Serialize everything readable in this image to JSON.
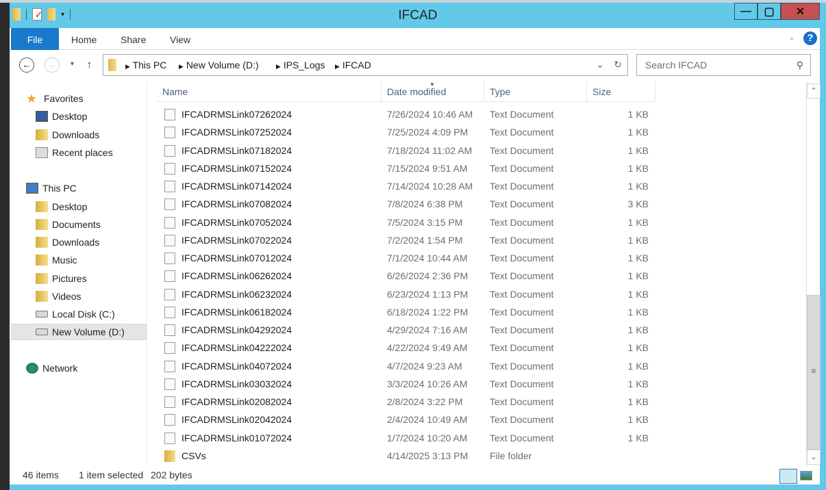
{
  "window": {
    "title": "IFCAD",
    "minimize": "—",
    "maximize": "▢",
    "close": "✕"
  },
  "ribbon": {
    "tabs": [
      "File",
      "Home",
      "Share",
      "View"
    ],
    "help": "?"
  },
  "address": {
    "crumbs": [
      "This PC",
      "New Volume (D:)",
      "IPS_Logs",
      "IFCAD"
    ]
  },
  "search": {
    "placeholder": "Search IFCAD"
  },
  "nav": {
    "favorites": "Favorites",
    "fav_items": [
      "Desktop",
      "Downloads",
      "Recent places"
    ],
    "this_pc": "This PC",
    "pc_items": [
      "Desktop",
      "Documents",
      "Downloads",
      "Music",
      "Pictures",
      "Videos",
      "Local Disk (C:)",
      "New Volume (D:)"
    ],
    "network": "Network",
    "selected": "New Volume (D:)"
  },
  "columns": {
    "name": "Name",
    "date": "Date modified",
    "type": "Type",
    "size": "Size"
  },
  "files": [
    {
      "name": "IFCADRMSLink07262024",
      "date": "7/26/2024 10:46 AM",
      "type": "Text Document",
      "size": "1 KB"
    },
    {
      "name": "IFCADRMSLink07252024",
      "date": "7/25/2024 4:09 PM",
      "type": "Text Document",
      "size": "1 KB"
    },
    {
      "name": "IFCADRMSLink07182024",
      "date": "7/18/2024 11:02 AM",
      "type": "Text Document",
      "size": "1 KB"
    },
    {
      "name": "IFCADRMSLink07152024",
      "date": "7/15/2024 9:51 AM",
      "type": "Text Document",
      "size": "1 KB"
    },
    {
      "name": "IFCADRMSLink07142024",
      "date": "7/14/2024 10:28 AM",
      "type": "Text Document",
      "size": "1 KB"
    },
    {
      "name": "IFCADRMSLink07082024",
      "date": "7/8/2024 6:38 PM",
      "type": "Text Document",
      "size": "3 KB"
    },
    {
      "name": "IFCADRMSLink07052024",
      "date": "7/5/2024 3:15 PM",
      "type": "Text Document",
      "size": "1 KB"
    },
    {
      "name": "IFCADRMSLink07022024",
      "date": "7/2/2024 1:54 PM",
      "type": "Text Document",
      "size": "1 KB"
    },
    {
      "name": "IFCADRMSLink07012024",
      "date": "7/1/2024 10:44 AM",
      "type": "Text Document",
      "size": "1 KB"
    },
    {
      "name": "IFCADRMSLink06262024",
      "date": "6/26/2024 2:36 PM",
      "type": "Text Document",
      "size": "1 KB"
    },
    {
      "name": "IFCADRMSLink06232024",
      "date": "6/23/2024 1:13 PM",
      "type": "Text Document",
      "size": "1 KB"
    },
    {
      "name": "IFCADRMSLink06182024",
      "date": "6/18/2024 1:22 PM",
      "type": "Text Document",
      "size": "1 KB"
    },
    {
      "name": "IFCADRMSLink04292024",
      "date": "4/29/2024 7:16 AM",
      "type": "Text Document",
      "size": "1 KB"
    },
    {
      "name": "IFCADRMSLink04222024",
      "date": "4/22/2024 9:49 AM",
      "type": "Text Document",
      "size": "1 KB"
    },
    {
      "name": "IFCADRMSLink04072024",
      "date": "4/7/2024 9:23 AM",
      "type": "Text Document",
      "size": "1 KB"
    },
    {
      "name": "IFCADRMSLink03032024",
      "date": "3/3/2024 10:26 AM",
      "type": "Text Document",
      "size": "1 KB"
    },
    {
      "name": "IFCADRMSLink02082024",
      "date": "2/8/2024 3:22 PM",
      "type": "Text Document",
      "size": "1 KB"
    },
    {
      "name": "IFCADRMSLink02042024",
      "date": "2/4/2024 10:49 AM",
      "type": "Text Document",
      "size": "1 KB"
    },
    {
      "name": "IFCADRMSLink01072024",
      "date": "1/7/2024 10:20 AM",
      "type": "Text Document",
      "size": "1 KB"
    },
    {
      "name": "CSVs",
      "date": "4/14/2025 3:13 PM",
      "type": "File folder",
      "size": ""
    }
  ],
  "status": {
    "count": "46 items",
    "selected": "1 item selected",
    "bytes": "202 bytes"
  }
}
